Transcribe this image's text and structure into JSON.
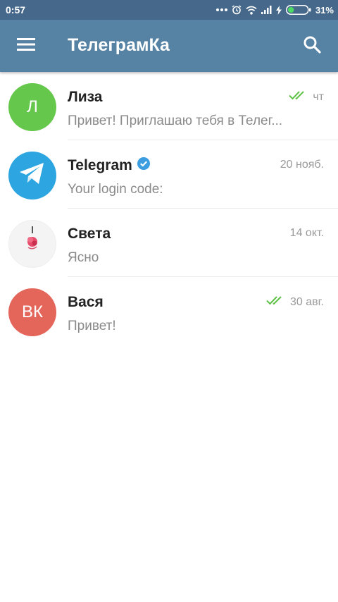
{
  "status_bar": {
    "time": "0:57",
    "battery_percent": "31%",
    "battery_level": 0.31,
    "icons": [
      "more-dots-icon",
      "alarm-icon",
      "wifi-icon",
      "signal-icon",
      "charging-icon",
      "battery-icon"
    ]
  },
  "app_bar": {
    "title": "ТелеграмКа",
    "menu_icon": "hamburger-menu-icon",
    "search_icon": "search-icon",
    "color": "#5682a3"
  },
  "chats": [
    {
      "name": "Лиза",
      "avatar_letter": "Л",
      "avatar_color": "#66c74d",
      "message": "Привет! Приглашаю тебя в Телег...",
      "time": "чт",
      "read_ticks": true,
      "verified": false
    },
    {
      "name": "Telegram",
      "avatar_icon": "telegram-plane-icon",
      "avatar_color": "#2da5e1",
      "message": "Your login code:",
      "time": "20 нояб.",
      "read_ticks": false,
      "verified": true
    },
    {
      "name": "Света",
      "avatar_icon": "flower-photo-icon",
      "avatar_color": "#f2f2f2",
      "message": "Ясно",
      "time": "14 окт.",
      "read_ticks": false,
      "verified": false
    },
    {
      "name": "Вася",
      "avatar_letter": "ВК",
      "avatar_color": "#e4655a",
      "message": "Привет!",
      "time": "30 авг.",
      "read_ticks": true,
      "verified": false
    }
  ]
}
